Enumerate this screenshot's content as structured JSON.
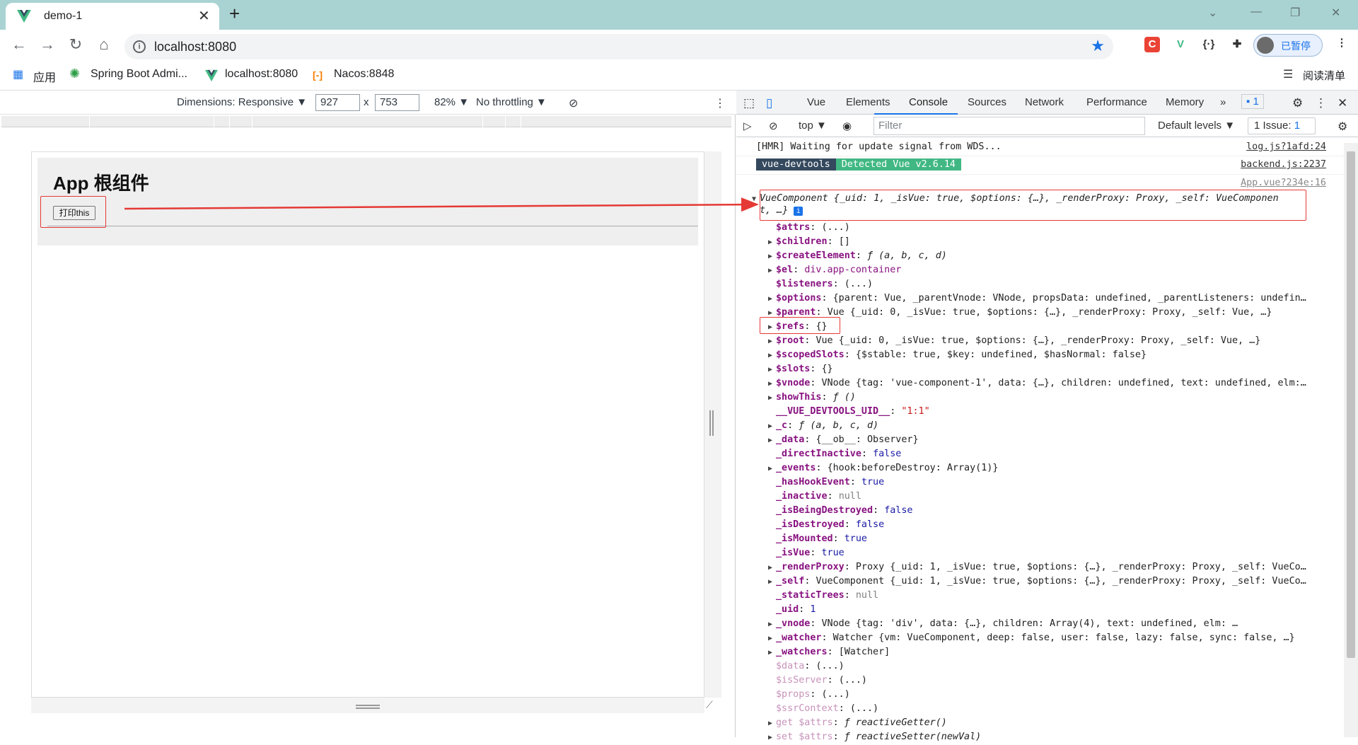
{
  "browser": {
    "tab_title": "demo-1",
    "tab_close": "✕",
    "new_tab": "+",
    "url": "localhost:8080",
    "profile_label": "已暂停"
  },
  "bookmarks": [
    {
      "label": "应用"
    },
    {
      "label": "Spring Boot Admi..."
    },
    {
      "label": "localhost:8080"
    },
    {
      "label": "Nacos:8848"
    }
  ],
  "reading_list": "阅读清单",
  "device_toolbar": {
    "dimensions": "Dimensions: Responsive ▼",
    "width": "927",
    "times": "x",
    "height": "753",
    "zoom": "82% ▼",
    "throttling": "No throttling ▼"
  },
  "page": {
    "title": "App 根组件",
    "button_label": "打印this"
  },
  "devtools": {
    "tabs": [
      "Vue",
      "Elements",
      "Console",
      "Sources",
      "Network",
      "Performance",
      "Memory"
    ],
    "more": "»",
    "messages_badge": "1",
    "context": "top ▼",
    "filter_placeholder": "Filter",
    "levels": "Default levels ▼",
    "issues": "1 Issue: ",
    "issues_count": "1"
  },
  "console": {
    "hmr_msg": "[HMR] Waiting for update signal from WDS...",
    "hmr_src": "log.js?1afd:24",
    "badge_a": "vue-devtools",
    "badge_b": "Detected Vue v2.6.14",
    "backend_src": "backend.js:2237",
    "app_src": "App.vue?234e:16",
    "component_line1": "VueComponent {_uid: 1, _isVue: true, $options: {…}, _renderProxy: Proxy, _self: VueComponen",
    "component_line2": "t, …}",
    "props": [
      {
        "tri": "",
        "key": "$attrs",
        "val": "(...)",
        "dim": false
      },
      {
        "tri": "▶",
        "key": "$children",
        "val": "[]",
        "dim": false
      },
      {
        "tri": "▶",
        "key": "$createElement",
        "val": "ƒ (a, b, c, d)",
        "dim": false
      },
      {
        "tri": "▶",
        "key": "$el",
        "val": "div.app-container",
        "dim": false
      },
      {
        "tri": "",
        "key": "$listeners",
        "val": "(...)",
        "dim": false
      },
      {
        "tri": "▶",
        "key": "$options",
        "val": "{parent: Vue, _parentVnode: VNode, propsData: undefined, _parentListeners: undefin…",
        "dim": false
      },
      {
        "tri": "▶",
        "key": "$parent",
        "val": "Vue {_uid: 0, _isVue: true, $options: {…}, _renderProxy: Proxy, _self: Vue, …}",
        "dim": false
      },
      {
        "tri": "▶",
        "key": "$refs",
        "val": "{}",
        "dim": false
      },
      {
        "tri": "▶",
        "key": "$root",
        "val": "Vue {_uid: 0, _isVue: true, $options: {…}, _renderProxy: Proxy, _self: Vue, …}",
        "dim": false
      },
      {
        "tri": "▶",
        "key": "$scopedSlots",
        "val": "{$stable: true, $key: undefined, $hasNormal: false}",
        "dim": false
      },
      {
        "tri": "▶",
        "key": "$slots",
        "val": "{}",
        "dim": false
      },
      {
        "tri": "▶",
        "key": "$vnode",
        "val": "VNode {tag: 'vue-component-1', data: {…}, children: undefined, text: undefined, elm:…",
        "dim": false
      },
      {
        "tri": "▶",
        "key": "showThis",
        "val": "ƒ ()",
        "dim": false
      },
      {
        "tri": "",
        "key": "__VUE_DEVTOOLS_UID__",
        "val": "\"1:1\"",
        "dim": false
      },
      {
        "tri": "▶",
        "key": "_c",
        "val": "ƒ (a, b, c, d)",
        "dim": false
      },
      {
        "tri": "▶",
        "key": "_data",
        "val": "{__ob__: Observer}",
        "dim": false
      },
      {
        "tri": "",
        "key": "_directInactive",
        "val": "false",
        "dim": false
      },
      {
        "tri": "▶",
        "key": "_events",
        "val": "{hook:beforeDestroy: Array(1)}",
        "dim": false
      },
      {
        "tri": "",
        "key": "_hasHookEvent",
        "val": "true",
        "dim": false
      },
      {
        "tri": "",
        "key": "_inactive",
        "val": "null",
        "dim": false
      },
      {
        "tri": "",
        "key": "_isBeingDestroyed",
        "val": "false",
        "dim": false
      },
      {
        "tri": "",
        "key": "_isDestroyed",
        "val": "false",
        "dim": false
      },
      {
        "tri": "",
        "key": "_isMounted",
        "val": "true",
        "dim": false
      },
      {
        "tri": "",
        "key": "_isVue",
        "val": "true",
        "dim": false
      },
      {
        "tri": "▶",
        "key": "_renderProxy",
        "val": "Proxy {_uid: 1, _isVue: true, $options: {…}, _renderProxy: Proxy, _self: VueCo…",
        "dim": false
      },
      {
        "tri": "▶",
        "key": "_self",
        "val": "VueComponent {_uid: 1, _isVue: true, $options: {…}, _renderProxy: Proxy, _self: VueCo…",
        "dim": false
      },
      {
        "tri": "",
        "key": "_staticTrees",
        "val": "null",
        "dim": false
      },
      {
        "tri": "",
        "key": "_uid",
        "val": "1",
        "dim": false
      },
      {
        "tri": "▶",
        "key": "_vnode",
        "val": "VNode {tag: 'div', data: {…}, children: Array(4), text: undefined, elm: …",
        "dim": false
      },
      {
        "tri": "▶",
        "key": "_watcher",
        "val": "Watcher {vm: VueComponent, deep: false, user: false, lazy: false, sync: false, …}",
        "dim": false
      },
      {
        "tri": "▶",
        "key": "_watchers",
        "val": "[Watcher]",
        "dim": false
      },
      {
        "tri": "",
        "key": "$data",
        "val": "(...)",
        "dim": true
      },
      {
        "tri": "",
        "key": "$isServer",
        "val": "(...)",
        "dim": true
      },
      {
        "tri": "",
        "key": "$props",
        "val": "(...)",
        "dim": true
      },
      {
        "tri": "",
        "key": "$ssrContext",
        "val": "(...)",
        "dim": true
      },
      {
        "tri": "▶",
        "key": "get $attrs",
        "val": "ƒ reactiveGetter()",
        "dim": true
      },
      {
        "tri": "▶",
        "key": "set $attrs",
        "val": "ƒ reactiveSetter(newVal)",
        "dim": true
      }
    ]
  },
  "colors": {
    "tabstrip": "#a9d3d2",
    "accent": "#1a73e8",
    "highlight": "#e53935",
    "vue_green": "#41b883"
  }
}
